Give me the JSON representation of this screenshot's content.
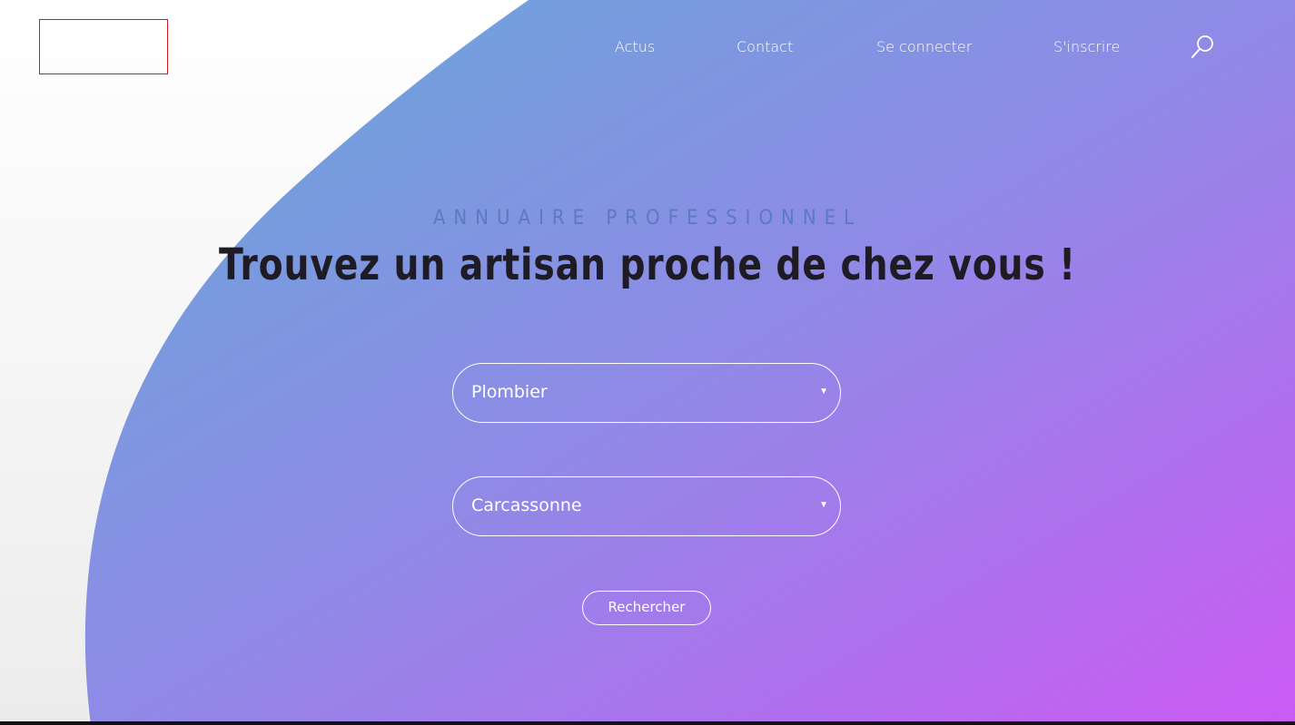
{
  "nav": {
    "items": [
      {
        "label": "Actus"
      },
      {
        "label": "Contact"
      },
      {
        "label": "Se connecter"
      },
      {
        "label": "S'inscrire"
      }
    ],
    "search_icon": "magnifier-icon"
  },
  "hero": {
    "overline": "ANNUAIRE PROFESSIONNEL",
    "title": "Trouvez un artisan proche de chez vous !",
    "gradient": {
      "start": "#6aa6da",
      "end": "#c85cf2"
    }
  },
  "form": {
    "metier": {
      "selected": "Plombier"
    },
    "ville": {
      "selected": "Carcassonne"
    },
    "submit_label": "Rechercher"
  }
}
